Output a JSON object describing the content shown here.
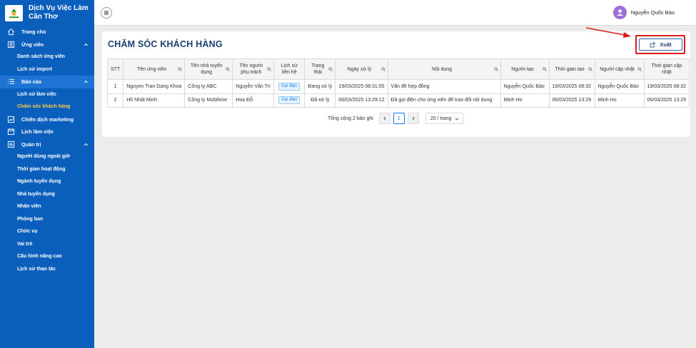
{
  "app": {
    "brand_line1": "Dịch Vụ Việc Làm",
    "brand_line2": "Cần Thơ"
  },
  "sidebar": {
    "items": [
      {
        "label": "Trang chủ",
        "icon": "home-icon"
      },
      {
        "label": "Ứng viên",
        "icon": "user-icon",
        "expanded": true
      },
      {
        "label": "Danh sách ứng viên",
        "sub": true
      },
      {
        "label": "Lịch sử import",
        "sub": true
      },
      {
        "label": "Báo cáo",
        "icon": "list-icon",
        "expanded": true
      },
      {
        "label": "Lịch sử làm việc",
        "sub": true
      },
      {
        "label": "Chăm sóc khách hàng",
        "sub": true,
        "active": true
      },
      {
        "label": "Chiến dịch marketing",
        "icon": "chart-icon"
      },
      {
        "label": "Lịch làm việc",
        "icon": "calendar-icon"
      },
      {
        "label": "Quản trị",
        "icon": "admin-icon",
        "expanded": true
      },
      {
        "label": "Người dùng ngoài giờ",
        "sub": true
      },
      {
        "label": "Thời gian hoạt động",
        "sub": true
      },
      {
        "label": "Ngành tuyển dụng",
        "sub": true
      },
      {
        "label": "Nhà tuyển dụng",
        "sub": true
      },
      {
        "label": "Nhân viên",
        "sub": true
      },
      {
        "label": "Phòng ban",
        "sub": true
      },
      {
        "label": "Chức vụ",
        "sub": true
      },
      {
        "label": "Vai trò",
        "sub": true
      },
      {
        "label": "Cấu hình nâng cao",
        "sub": true
      },
      {
        "label": "Lịch sử thao tác",
        "sub": true
      }
    ]
  },
  "header": {
    "user_name": "Nguyễn Quốc Bảo"
  },
  "main": {
    "title": "CHĂM SÓC KHÁCH HÀNG",
    "export_label": "Xuất",
    "columns": [
      "STT",
      "Tên ứng viên",
      "Tên nhà tuyển dụng",
      "Tên người phụ trách",
      "Lịch sử liên hệ",
      "Trạng thái",
      "Ngày xử lý",
      "Nội dung",
      "Người tạo",
      "Thời gian tạo",
      "Người cập nhật",
      "Thời gian cập nhật"
    ],
    "rows": [
      [
        "1",
        "Nguyen Tran Dang Khoa",
        "Công ty ABC",
        "Nguyễn Văn Trí",
        "Gọi điện",
        "Đang xử lý",
        "19/03/2025 08:31:55",
        "Vấn đề hợp đồng",
        "Nguyễn Quốc Bảo",
        "19/03/2025 08:32",
        "Nguyễn Quốc Bảo",
        "19/03/2025 08:32"
      ],
      [
        "2",
        "Hồ Nhật Minh",
        "Công ty Mobifone",
        "Hoa Đỗ",
        "Gọi điện",
        "Đã xử lý",
        "06/03/2025 13:29:12",
        "Đã gọi điện cho ứng viên để trao đổi nội dung",
        "Minh Ho",
        "06/03/2025 13:29",
        "Minh Ho",
        "06/03/2025 13:29"
      ]
    ],
    "pagination": {
      "total_text": "Tổng cộng 2 bản ghi",
      "current_page": "1",
      "page_size": "20 / trang"
    }
  },
  "colors": {
    "sidebar_bg": "#0a5fbd",
    "active_text": "#ffc93c",
    "highlight": "#e01b1b",
    "title": "#1c3f73"
  }
}
